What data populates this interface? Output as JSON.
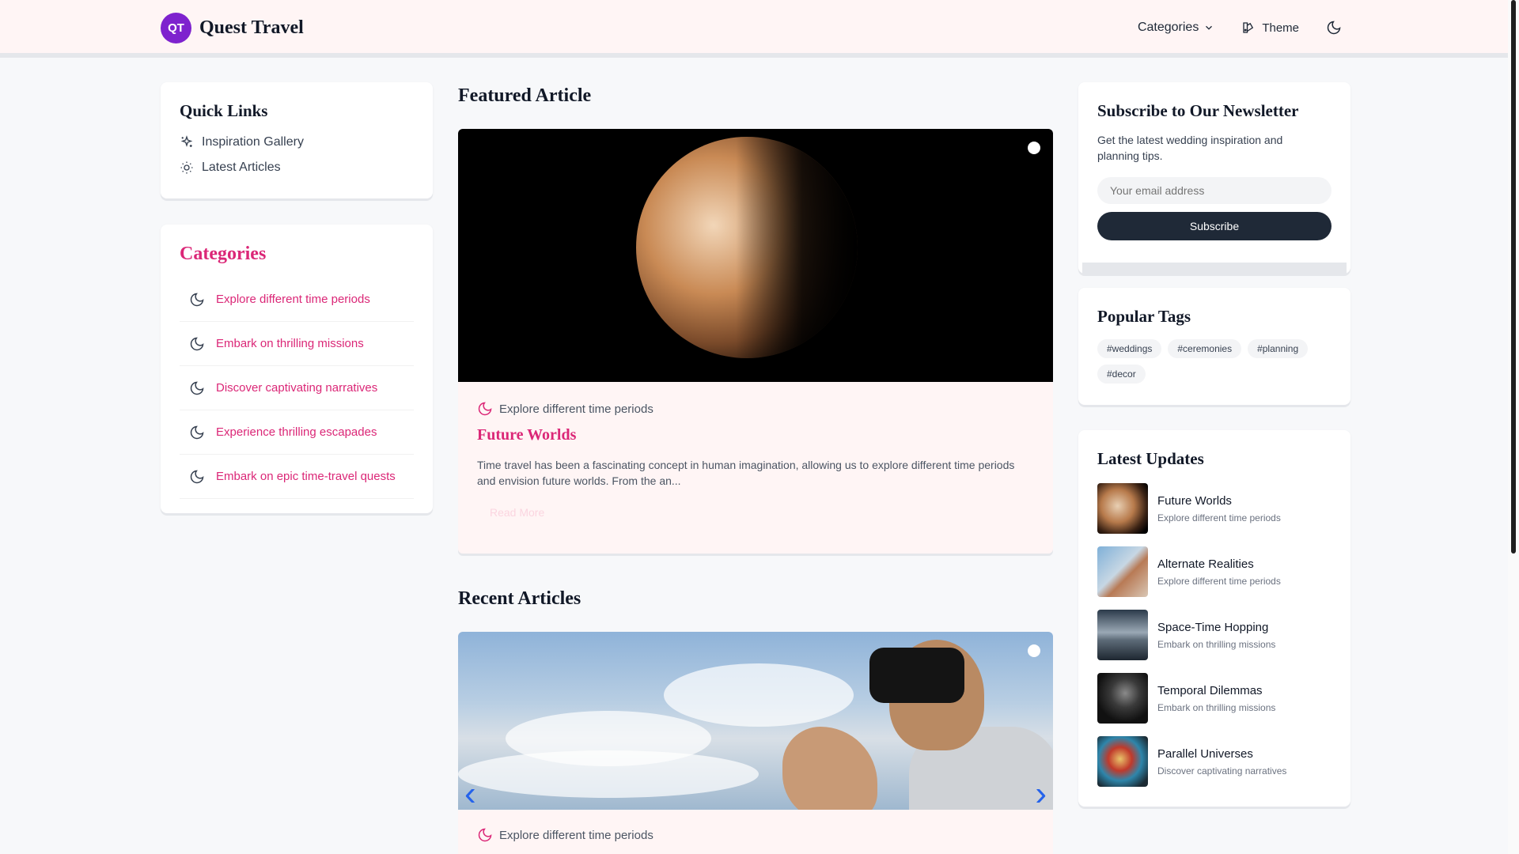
{
  "header": {
    "logo_initials": "QT",
    "brand_name": "Quest Travel",
    "categories_label": "Categories",
    "theme_label": "Theme"
  },
  "quick_links": {
    "title": "Quick Links",
    "items": [
      {
        "label": "Inspiration Gallery",
        "icon": "sparkles-icon"
      },
      {
        "label": "Latest Articles",
        "icon": "sun-icon"
      }
    ]
  },
  "categories": {
    "title": "Categories",
    "items": [
      "Explore different time periods",
      "Embark on thrilling missions",
      "Discover captivating narratives",
      "Experience thrilling escapades",
      "Embark on epic time-travel quests"
    ]
  },
  "featured": {
    "section_title": "Featured Article",
    "category": "Explore different time periods",
    "title": "Future Worlds",
    "excerpt": "Time travel has been a fascinating concept in human imagination, allowing us to explore different time periods and envision future worlds. From the an...",
    "read_more": "Read More"
  },
  "recent": {
    "section_title": "Recent Articles",
    "category": "Explore different time periods"
  },
  "newsletter": {
    "title": "Subscribe to Our Newsletter",
    "description": "Get the latest wedding inspiration and planning tips.",
    "email_placeholder": "Your email address",
    "button_label": "Subscribe"
  },
  "tags": {
    "title": "Popular Tags",
    "items": [
      "#weddings",
      "#ceremonies",
      "#planning",
      "#decor"
    ]
  },
  "updates": {
    "title": "Latest Updates",
    "items": [
      {
        "title": "Future Worlds",
        "category": "Explore different time periods"
      },
      {
        "title": "Alternate Realities",
        "category": "Explore different time periods"
      },
      {
        "title": "Space-Time Hopping",
        "category": "Embark on thrilling missions"
      },
      {
        "title": "Temporal Dilemmas",
        "category": "Embark on thrilling missions"
      },
      {
        "title": "Parallel Universes",
        "category": "Discover captivating narratives"
      }
    ]
  },
  "colors": {
    "accent_pink": "#db2777",
    "logo_purple": "#7e22ce",
    "dark_button": "#1f2937",
    "header_bg": "#fff5f5"
  }
}
